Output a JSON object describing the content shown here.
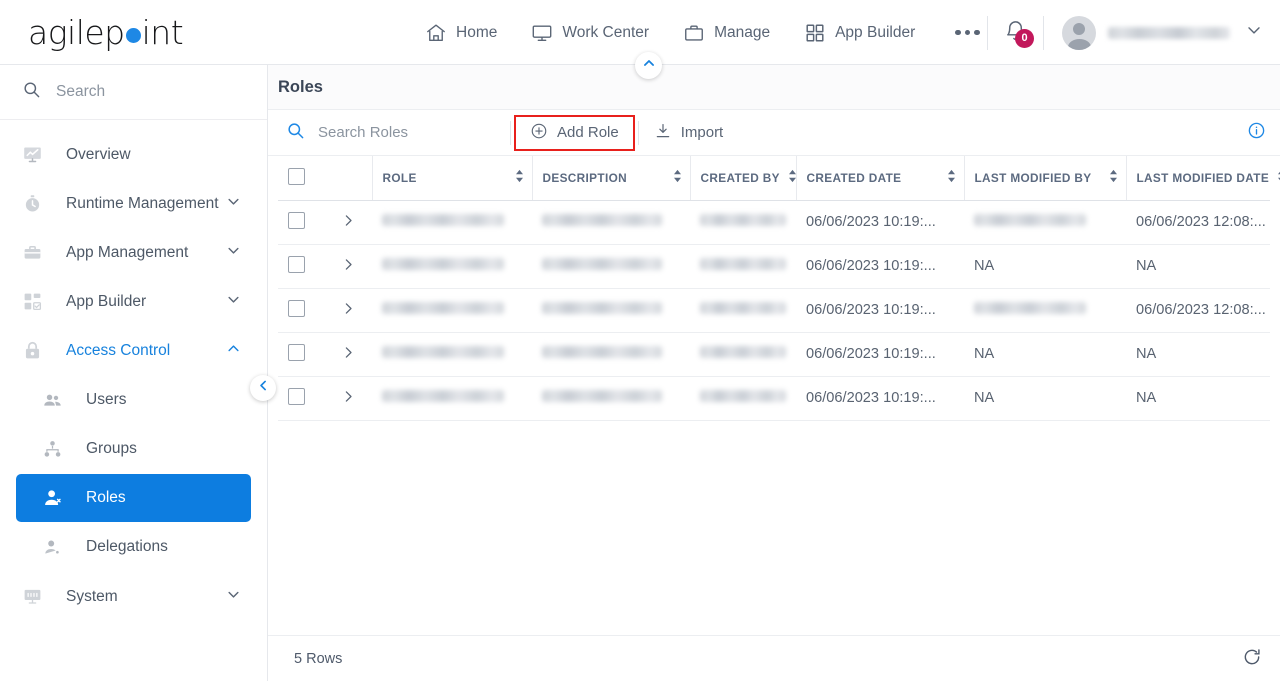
{
  "brand": {
    "name_part1": "agilep",
    "name_part2": "int",
    "dot_color": "#1E88E5"
  },
  "topnav": {
    "items": [
      {
        "label": "Home",
        "icon": "home-icon"
      },
      {
        "label": "Work Center",
        "icon": "monitor-icon"
      },
      {
        "label": "Manage",
        "icon": "briefcase-icon"
      },
      {
        "label": "App Builder",
        "icon": "grid-icon"
      }
    ],
    "more_label": "more-options",
    "notifications": {
      "count": "0",
      "badge_color": "#C2185B"
    },
    "user": {
      "name": "",
      "name_blurred": true
    }
  },
  "sidebar": {
    "search": {
      "placeholder": "Search",
      "value": ""
    },
    "items": [
      {
        "label": "Overview",
        "icon": "chart-monitor-icon",
        "expandable": false
      },
      {
        "label": "Runtime Management",
        "icon": "stopwatch-icon",
        "expandable": true,
        "expanded": false
      },
      {
        "label": "App Management",
        "icon": "briefcase-icon",
        "expandable": true,
        "expanded": false
      },
      {
        "label": "App Builder",
        "icon": "grid-check-icon",
        "expandable": true,
        "expanded": false
      },
      {
        "label": "Access Control",
        "icon": "lock-icon",
        "expandable": true,
        "expanded": true
      },
      {
        "label": "System",
        "icon": "server-monitor-icon",
        "expandable": true,
        "expanded": false
      }
    ],
    "subitems": [
      {
        "label": "Users",
        "icon": "users-icon",
        "active": false
      },
      {
        "label": "Groups",
        "icon": "group-tree-icon",
        "active": false
      },
      {
        "label": "Roles",
        "icon": "role-person-icon",
        "active": true
      },
      {
        "label": "Delegations",
        "icon": "delegation-person-icon",
        "active": false
      }
    ],
    "active_color": "#0D7DE0",
    "expanded_color": "#1782DD"
  },
  "main": {
    "page_title": "Roles",
    "toolbar": {
      "search_placeholder": "Search Roles",
      "search_value": "",
      "add_role_label": "Add Role",
      "import_label": "Import",
      "highlight_color": "#E8201C",
      "info_icon": "info-circle-icon"
    },
    "table": {
      "columns": [
        {
          "label": "ROLE",
          "sortable": true
        },
        {
          "label": "DESCRIPTION",
          "sortable": true
        },
        {
          "label": "CREATED BY",
          "sortable": true
        },
        {
          "label": "CREATED DATE",
          "sortable": true
        },
        {
          "label": "LAST MODIFIED BY",
          "sortable": true
        },
        {
          "label": "LAST MODIFIED DATE",
          "sortable": true
        }
      ],
      "rows": [
        {
          "role": "",
          "role_blurred": true,
          "description": "",
          "description_blurred": true,
          "created_by": "",
          "created_by_blurred": true,
          "created_date": "06/06/2023 10:19:...",
          "last_modified_by": "",
          "last_modified_by_blurred": true,
          "last_modified_date": "06/06/2023 12:08:..."
        },
        {
          "role": "",
          "role_blurred": true,
          "description": "",
          "description_blurred": true,
          "created_by": "",
          "created_by_blurred": true,
          "created_date": "06/06/2023 10:19:...",
          "last_modified_by": "NA",
          "last_modified_by_blurred": false,
          "last_modified_date": "NA"
        },
        {
          "role": "",
          "role_blurred": true,
          "description": "",
          "description_blurred": true,
          "created_by": "",
          "created_by_blurred": true,
          "created_date": "06/06/2023 10:19:...",
          "last_modified_by": "",
          "last_modified_by_blurred": true,
          "last_modified_date": "06/06/2023 12:08:..."
        },
        {
          "role": "",
          "role_blurred": true,
          "description": "",
          "description_blurred": true,
          "created_by": "",
          "created_by_blurred": true,
          "created_date": "06/06/2023 10:19:...",
          "last_modified_by": "NA",
          "last_modified_by_blurred": false,
          "last_modified_date": "NA"
        },
        {
          "role": "",
          "role_blurred": true,
          "description": "",
          "description_blurred": true,
          "created_by": "",
          "created_by_blurred": true,
          "created_date": "06/06/2023 10:19:...",
          "last_modified_by": "NA",
          "last_modified_by_blurred": false,
          "last_modified_date": "NA"
        }
      ]
    },
    "footer": {
      "row_count_label": "5 Rows",
      "refresh_icon": "refresh-icon"
    }
  }
}
